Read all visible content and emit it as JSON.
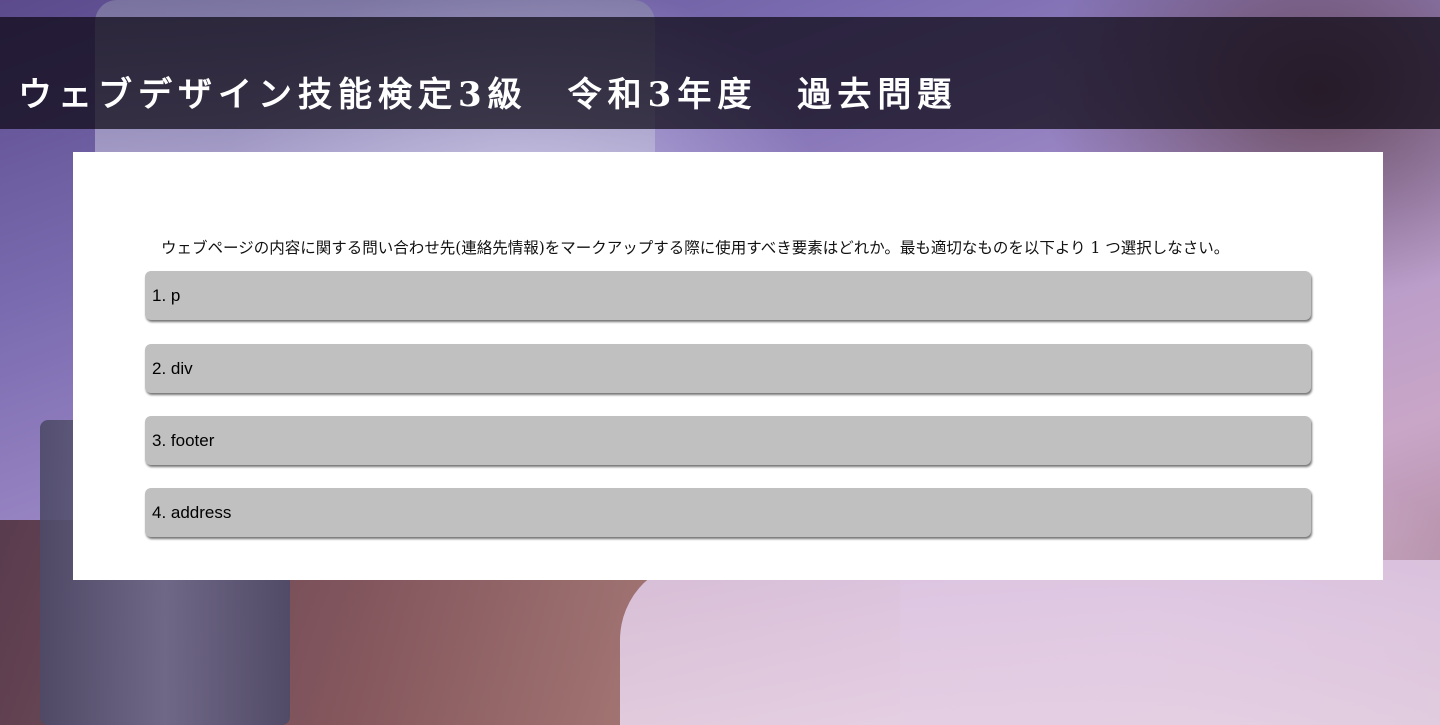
{
  "header": {
    "title": "ウェブデザイン技能検定3級　令和3年度　過去問題"
  },
  "quiz": {
    "question": "ウェブページの内容に関する問い合わせ先(連絡先情報)をマークアップする際に使用すべき要素はどれか。最も適切なものを以下より 1 つ選択しなさい。",
    "options": [
      {
        "label": "1. p"
      },
      {
        "label": "2. div"
      },
      {
        "label": "3. footer"
      },
      {
        "label": "4. address"
      }
    ]
  },
  "colors": {
    "header_bg": "#0c0814",
    "option_bg": "#c0c0c0",
    "card_bg": "#ffffff"
  }
}
